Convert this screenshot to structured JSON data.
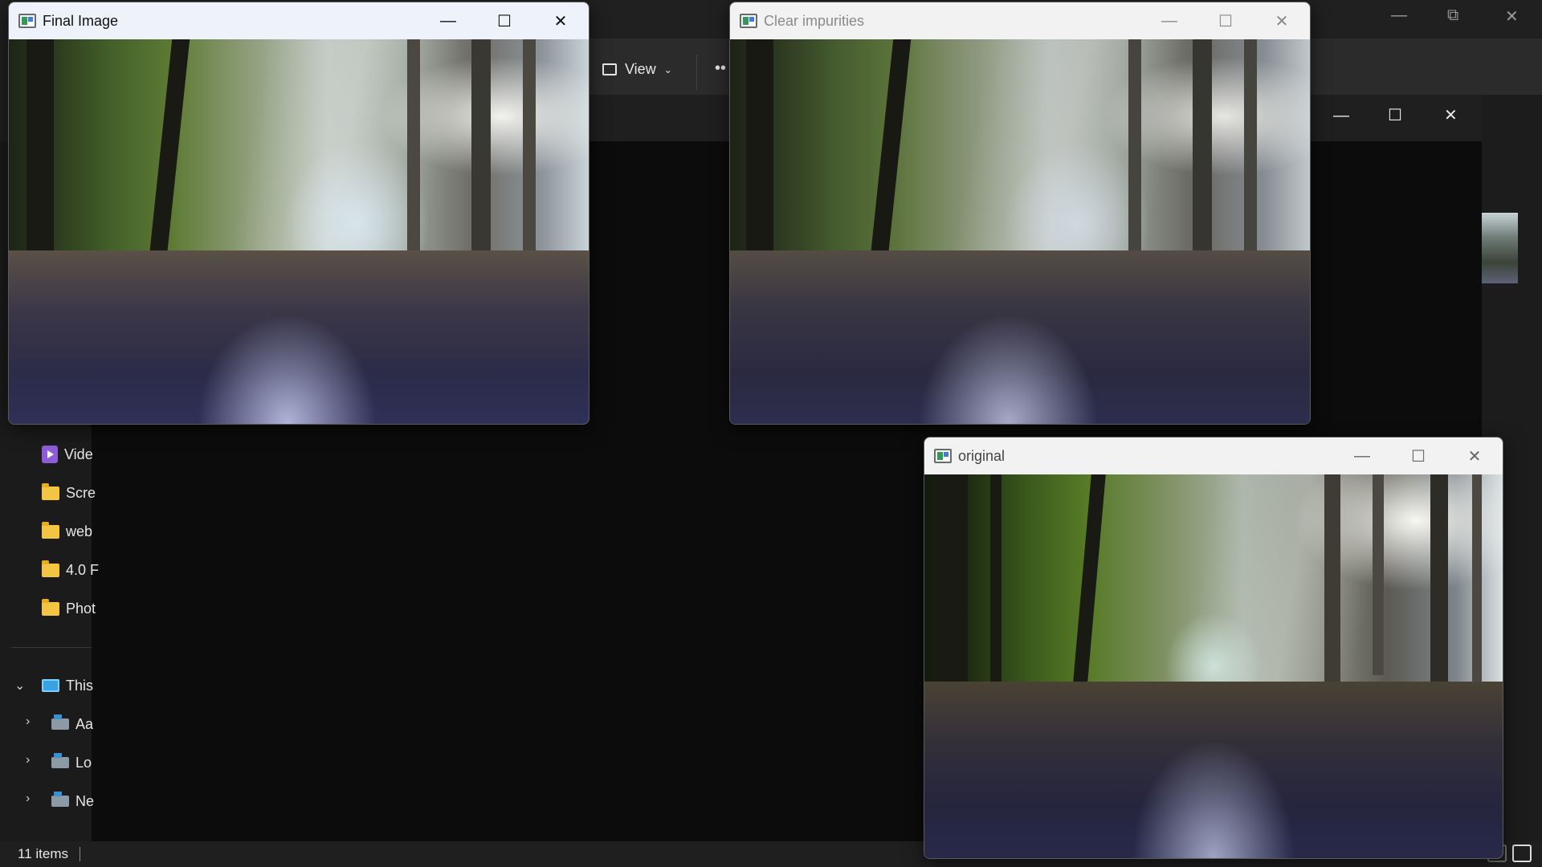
{
  "explorer": {
    "view_label": "View",
    "more_label": "••",
    "status_count": "11 items",
    "sidebar": [
      {
        "label": "Vide",
        "icon": "video-icon"
      },
      {
        "label": "Scre",
        "icon": "folder-icon"
      },
      {
        "label": "web",
        "icon": "folder-icon"
      },
      {
        "label": "4.0 F",
        "icon": "folder-icon"
      },
      {
        "label": "Phot",
        "icon": "folder-icon"
      },
      {
        "label": "This",
        "icon": "pc-icon"
      },
      {
        "label": "Aa",
        "icon": "drive-icon"
      },
      {
        "label": "Lo",
        "icon": "drive-icon"
      },
      {
        "label": "Ne",
        "icon": "drive-icon"
      }
    ]
  },
  "windows": {
    "final": {
      "title": "Final Image",
      "minimize": "—",
      "maximize": "☐",
      "close": "✕"
    },
    "clear": {
      "title": "Clear impurities",
      "minimize": "—",
      "maximize": "☐",
      "close": "✕"
    },
    "original": {
      "title": "original",
      "minimize": "—",
      "maximize": "☐",
      "close": "✕"
    }
  }
}
